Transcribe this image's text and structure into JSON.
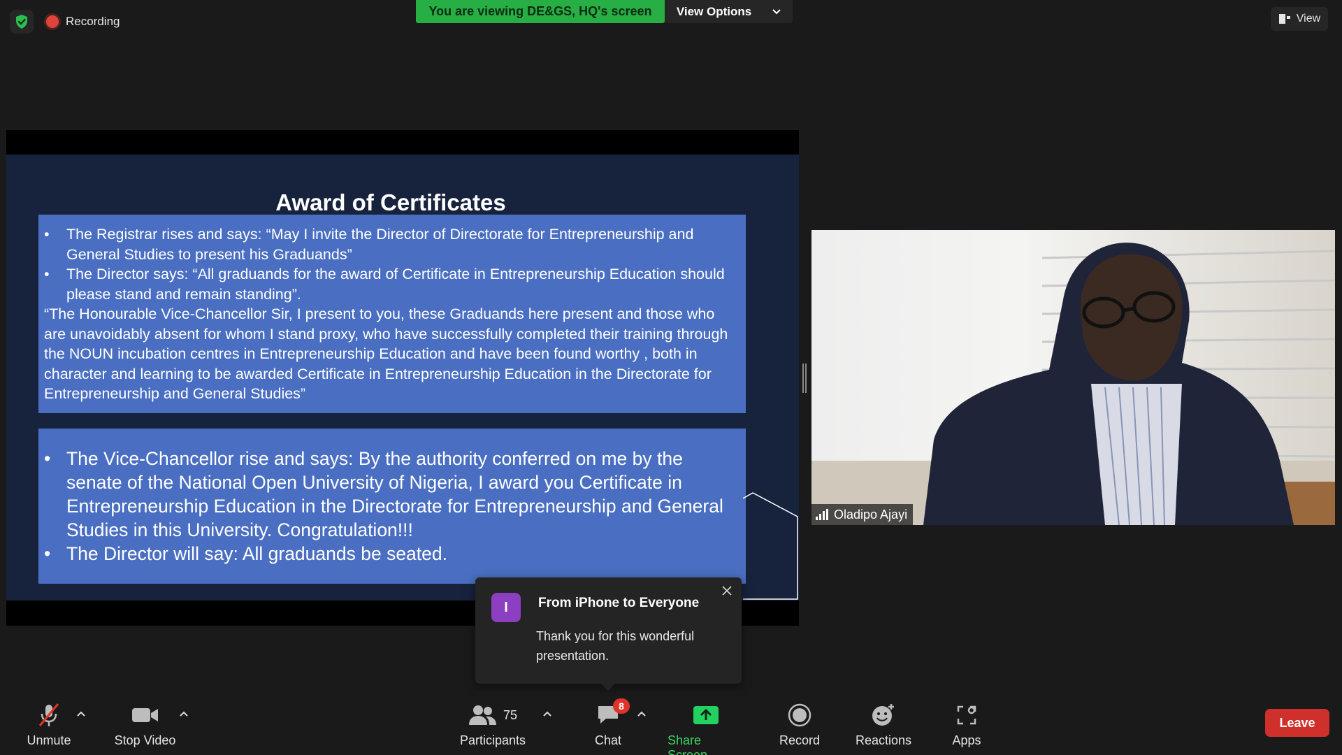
{
  "top": {
    "recording_label": "Recording",
    "viewing_banner": "You are viewing DE&GS, HQ's screen",
    "view_options_label": "View Options",
    "view_label": "View"
  },
  "slide": {
    "title": "Award of Certificates",
    "box1": {
      "bullet1": "The Registrar rises and says: “May I invite the Director of Directorate for Entrepreneurship and General Studies to present his Graduands”",
      "bullet2": "The Director says: “All graduands for the award of Certificate in Entrepreneurship Education should please stand and remain standing”.",
      "paragraph": "“The Honourable Vice-Chancellor Sir, I present to you, these Graduands here present and those who are unavoidably absent for whom I stand proxy, who have successfully completed their training through the NOUN incubation centres in Entrepreneurship Education and have been found worthy , both in character and learning to be awarded Certificate in Entrepreneurship Education in the Directorate for Entrepreneurship and General Studies”"
    },
    "box2": {
      "bullet1": "The Vice-Chancellor rise and says: By the authority conferred on me by the senate of the National Open University of Nigeria, I award you Certificate in Entrepreneurship Education in the Directorate for Entrepreneurship and General Studies in this University. Congratulation!!!",
      "bullet2": "The Director will say: All graduands be seated."
    }
  },
  "chat_popup": {
    "avatar_letter": "I",
    "from": "From iPhone to Everyone",
    "message": "Thank you for this wonderful presentation."
  },
  "video": {
    "participant_name": "Oladipo Ajayi"
  },
  "toolbar": {
    "unmute_label": "Unmute",
    "stop_video_label": "Stop Video",
    "participants_label": "Participants",
    "participants_count": "75",
    "chat_label": "Chat",
    "chat_badge": "8",
    "share_screen_label": "Share Screen",
    "record_label": "Record",
    "reactions_label": "Reactions",
    "apps_label": "Apps",
    "leave_label": "Leave"
  },
  "colors": {
    "banner_green": "#27ae45",
    "slide_box_blue": "#4a6fc2",
    "leave_red": "#d0302c",
    "share_screen_green": "#23d160"
  }
}
